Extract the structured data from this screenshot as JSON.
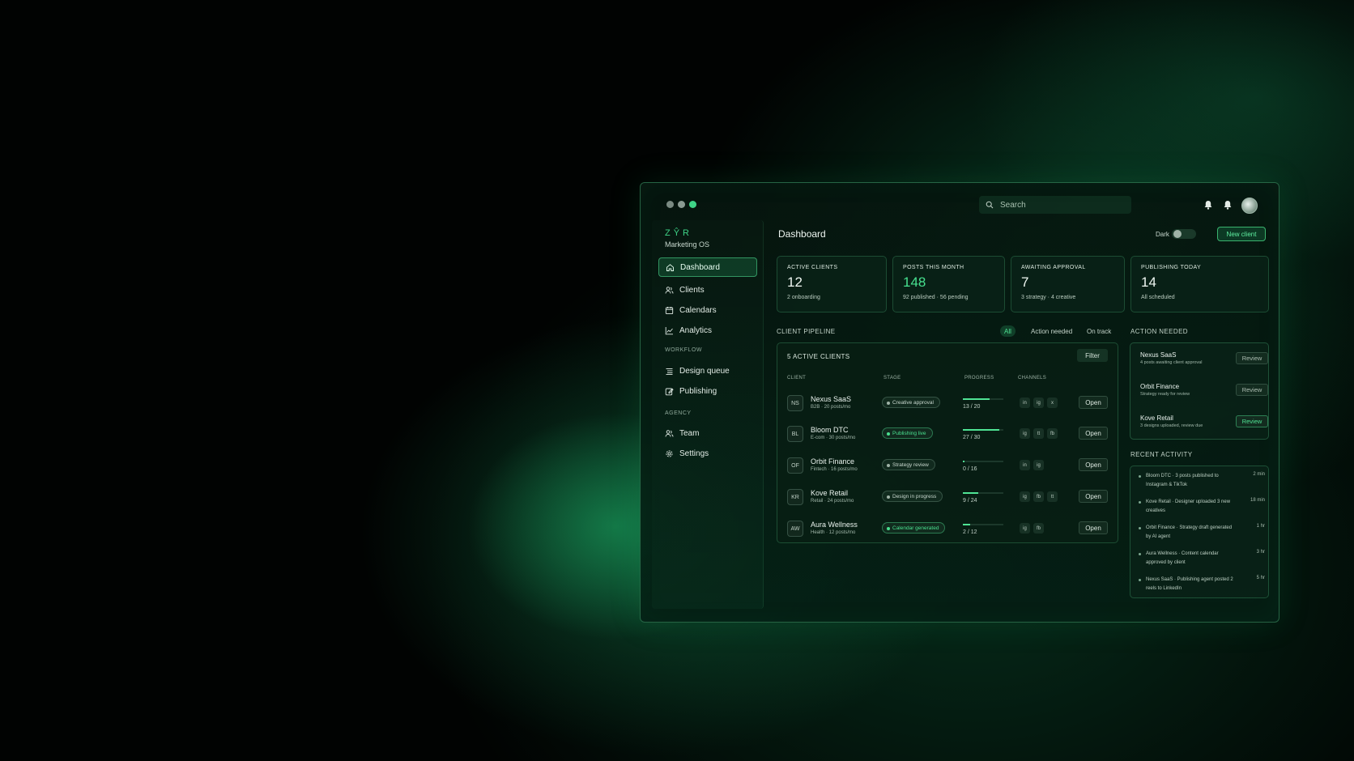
{
  "colors": {
    "accent": "#47e08f",
    "dot_grey_1": "#7a8a82",
    "dot_grey_2": "#8a9a92",
    "dot_green": "#3fd487"
  },
  "header": {
    "search_placeholder": "Search"
  },
  "brand": {
    "logo": "ZŶR",
    "subtitle": "Marketing OS"
  },
  "sidebar": {
    "items": [
      {
        "label": "Dashboard",
        "icon": "home-icon",
        "active": true
      },
      {
        "label": "Clients",
        "icon": "users-icon"
      },
      {
        "label": "Calendars",
        "icon": "calendar-icon"
      },
      {
        "label": "Analytics",
        "icon": "chart-line-icon"
      }
    ],
    "workflow_label": "WORKFLOW",
    "workflow": [
      {
        "label": "Design queue",
        "icon": "list-icon"
      },
      {
        "label": "Publishing",
        "icon": "edit-icon"
      }
    ],
    "agency_label": "AGENCY",
    "agency": [
      {
        "label": "Team",
        "icon": "users-icon"
      },
      {
        "label": "Settings",
        "icon": "gear-icon"
      }
    ]
  },
  "main": {
    "title": "Dashboard",
    "theme_label": "Dark",
    "new_client": "New client"
  },
  "stats": [
    {
      "label": "ACTIVE CLIENTS",
      "value": "12",
      "sub": "2 onboarding"
    },
    {
      "label": "POSTS THIS MONTH",
      "value": "148",
      "sub": "92 published · 56 pending"
    },
    {
      "label": "AWAITING APPROVAL",
      "value": "7",
      "sub": "3 strategy · 4 creative"
    },
    {
      "label": "PUBLISHING TODAY",
      "value": "14",
      "sub": "All scheduled"
    }
  ],
  "pipeline": {
    "heading": "CLIENT PIPELINE",
    "tabs": [
      "All",
      "Action needed",
      "On track"
    ],
    "title": "5 ACTIVE CLIENTS",
    "filter": "Filter",
    "columns": [
      "CLIENT",
      "STAGE",
      "PROGRESS",
      "CHANNELS"
    ],
    "open_label": "Open",
    "rows": [
      {
        "initials": "NS",
        "name": "Nexus SaaS",
        "meta": "B2B · 20 posts/mo",
        "stage": "Creative approval",
        "stage_green": false,
        "progress": "13 / 20",
        "fraction": 0.65,
        "channels": [
          "in",
          "ig",
          "x"
        ]
      },
      {
        "initials": "BL",
        "name": "Bloom DTC",
        "meta": "E-com · 30 posts/mo",
        "stage": "Publishing live",
        "stage_green": true,
        "progress": "27 / 30",
        "fraction": 0.9,
        "channels": [
          "ig",
          "tt",
          "fb"
        ]
      },
      {
        "initials": "OF",
        "name": "Orbit Finance",
        "meta": "Fintech · 16 posts/mo",
        "stage": "Strategy review",
        "stage_green": false,
        "progress": "0 / 16",
        "fraction": 0.04,
        "channels": [
          "in",
          "ig"
        ]
      },
      {
        "initials": "KR",
        "name": "Kove Retail",
        "meta": "Retail · 24 posts/mo",
        "stage": "Design in progress",
        "stage_green": false,
        "progress": "9 / 24",
        "fraction": 0.375,
        "channels": [
          "ig",
          "fb",
          "tt"
        ]
      },
      {
        "initials": "AW",
        "name": "Aura Wellness",
        "meta": "Health · 12 posts/mo",
        "stage": "Calendar generated",
        "stage_green": true,
        "progress": "2 / 12",
        "fraction": 0.17,
        "channels": [
          "ig",
          "fb"
        ]
      }
    ]
  },
  "action_needed": {
    "heading": "ACTION NEEDED",
    "items": [
      {
        "name": "Nexus SaaS",
        "desc": "4 posts awaiting client approval",
        "button": "Review",
        "green": false
      },
      {
        "name": "Orbit Finance",
        "desc": "Strategy ready for review",
        "button": "Review",
        "green": false
      },
      {
        "name": "Kove Retail",
        "desc": "3 designs uploaded, review due",
        "button": "Review",
        "green": true
      }
    ]
  },
  "recent_activity": {
    "heading": "RECENT ACTIVITY",
    "items": [
      {
        "text": "Bloom DTC · 3 posts published to Instagram & TikTok",
        "time": "2 min"
      },
      {
        "text": "Kove Retail · Designer uploaded 3 new creatives",
        "time": "18 min"
      },
      {
        "text": "Orbit Finance · Strategy draft generated by AI agent",
        "time": "1 hr"
      },
      {
        "text": "Aura Wellness · Content calendar approved by client",
        "time": "3 hr"
      },
      {
        "text": "Nexus SaaS · Publishing agent posted 2 reels to LinkedIn",
        "time": "5 hr"
      }
    ]
  }
}
